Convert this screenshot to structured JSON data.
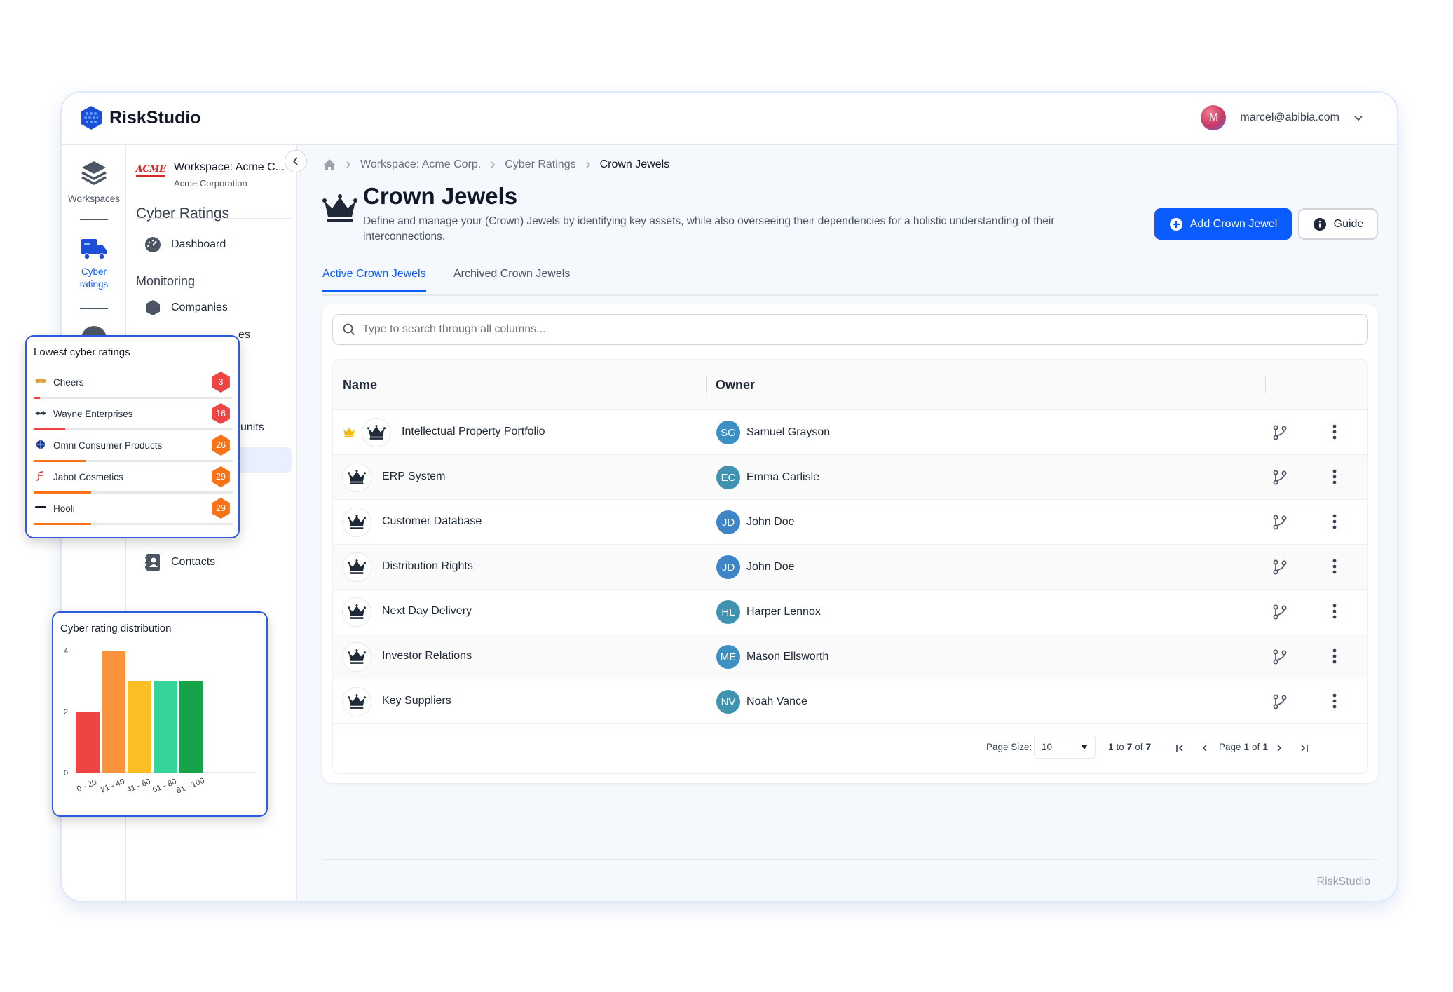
{
  "app": {
    "name": "RiskStudio",
    "user_avatar": "M",
    "user_email": "marcel@abibia.com",
    "accent": "#0b5cff"
  },
  "rail": [
    {
      "label": "Workspaces",
      "icon": "layers-icon"
    },
    {
      "label": "Cyber\nratings",
      "icon": "truck-icon"
    }
  ],
  "workspace": {
    "title": "Workspace: Acme C...",
    "subtitle": "Acme Corporation",
    "logo": "ACME"
  },
  "sidenav": {
    "heading": "Cyber Ratings",
    "dashboard": "Dashboard",
    "monitoring": "Monitoring",
    "companies": "Companies",
    "partial_1": "es",
    "partial_2": "l units",
    "contacts": "Contacts"
  },
  "breadcrumbs": [
    "Workspace: Acme Corp.",
    "Cyber Ratings",
    "Crown Jewels"
  ],
  "page": {
    "title": "Crown Jewels",
    "description": "Define and manage your (Crown) Jewels by identifying key assets, while also overseeing their dependencies for a holistic understanding of their interconnections.",
    "add_button": "Add Crown Jewel",
    "guide_button": "Guide"
  },
  "tabs": [
    "Active Crown Jewels",
    "Archived Crown Jewels"
  ],
  "search": {
    "placeholder": "Type to search through all columns..."
  },
  "table": {
    "columns": [
      "Name",
      "Owner"
    ],
    "rows": [
      {
        "name": "Intellectual Property Portfolio",
        "owner_initials": "SG",
        "owner": "Samuel Grayson",
        "starred": true
      },
      {
        "name": "ERP System",
        "owner_initials": "EC",
        "owner": "Emma Carlisle",
        "starred": false
      },
      {
        "name": "Customer Database",
        "owner_initials": "JD",
        "owner": "John Doe",
        "starred": false
      },
      {
        "name": "Distribution Rights",
        "owner_initials": "JD",
        "owner": "John Doe",
        "starred": false
      },
      {
        "name": "Next Day Delivery",
        "owner_initials": "HL",
        "owner": "Harper Lennox",
        "starred": false
      },
      {
        "name": "Investor Relations",
        "owner_initials": "ME",
        "owner": "Mason Ellsworth",
        "starred": false
      },
      {
        "name": "Key Suppliers",
        "owner_initials": "NV",
        "owner": "Noah Vance",
        "starred": false
      }
    ]
  },
  "pagination": {
    "size_label": "Page Size:",
    "size_value": "10",
    "from": "1",
    "to_word": "to",
    "to": "7",
    "of_word": "of",
    "total": "7",
    "page_word": "Page",
    "page": "1",
    "pages": "1"
  },
  "footer": {
    "brand": "RiskStudio"
  },
  "lowest_ratings": {
    "title": "Lowest cyber ratings",
    "items": [
      {
        "name": "Cheers",
        "score": 3,
        "color": "#ef4444"
      },
      {
        "name": "Wayne Enterprises",
        "score": 16,
        "color": "#ef4444"
      },
      {
        "name": "Omni Consumer Products",
        "score": 26,
        "color": "#f97316"
      },
      {
        "name": "Jabot Cosmetics",
        "score": 29,
        "color": "#f97316"
      },
      {
        "name": "Hooli",
        "score": 29,
        "color": "#f97316"
      }
    ]
  },
  "chart_data": {
    "type": "bar",
    "title": "Cyber rating distribution",
    "categories": [
      "0 - 20",
      "21 - 40",
      "41 - 60",
      "61 - 80",
      "81 - 100"
    ],
    "values": [
      2,
      4,
      3,
      3,
      3
    ],
    "colors": [
      "#ef4444",
      "#fb923c",
      "#fbbf24",
      "#34d399",
      "#16a34a"
    ],
    "yticks": [
      0,
      2,
      4
    ],
    "ylim": [
      0,
      4
    ],
    "grid": false,
    "legend": "none"
  }
}
